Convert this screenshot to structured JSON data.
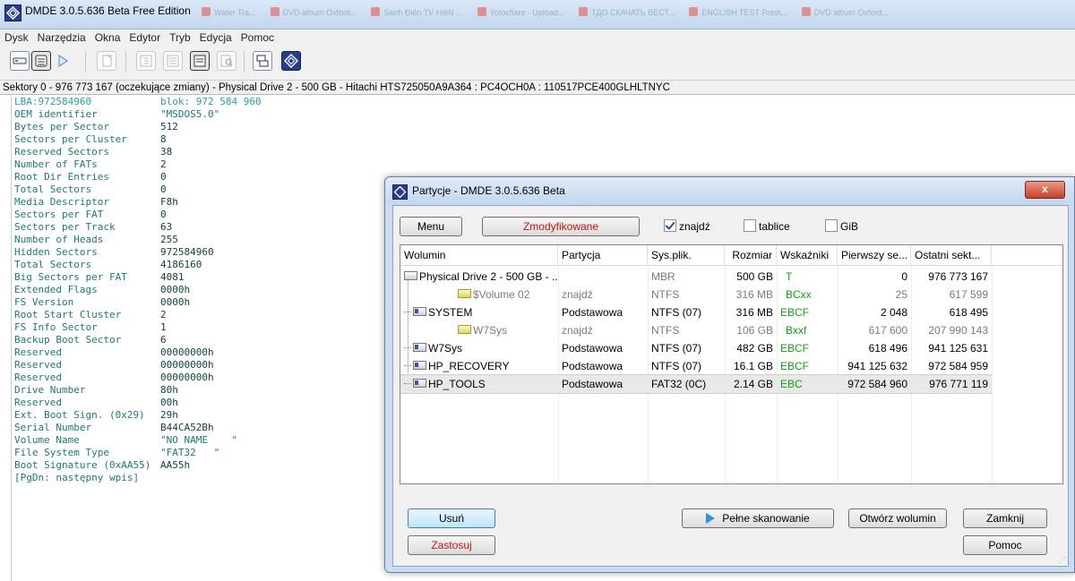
{
  "window": {
    "title": "DMDE 3.0.5.636 Beta Free Edition",
    "taskbar_tabs": [
      "Water Tra...",
      "DVD album Oxford...",
      "Sanh Điện TV HiềN ...",
      "Yotocflare - Upload...",
      "ТДО СКАЧАТЬ ВЕСТ...",
      "ENGLISH TEST Prest...",
      "DVD album Oxford..."
    ]
  },
  "menu": [
    "Dysk",
    "Narzędzia",
    "Okna",
    "Edytor",
    "Tryb",
    "Edycja",
    "Pomoc"
  ],
  "status_line": "Sektory 0 - 976 773 167 (oczekujące zmiany) - Physical Drive 2 - 500 GB - Hitachi HTS725050A9A364 : PC4OCH0A : 110517PCE400GLHLTNYC",
  "sector": {
    "header": {
      "k": "LBA:972584960",
      "v": "blok: 972 584 960"
    },
    "rows": [
      {
        "k": "OEM identifier",
        "v": "\"MSDOS5.0\""
      },
      {
        "k": "Bytes per Sector",
        "v": "512"
      },
      {
        "k": "Sectors per Cluster",
        "v": "8"
      },
      {
        "k": "Reserved Sectors",
        "v": "38"
      },
      {
        "k": "Number of FATs",
        "v": "2"
      },
      {
        "k": "Root Dir Entries",
        "v": "0"
      },
      {
        "k": "Total Sectors",
        "v": "0"
      },
      {
        "k": "Media Descriptor",
        "v": "F8h"
      },
      {
        "k": "Sectors per FAT",
        "v": "0"
      },
      {
        "k": "Sectors per Track",
        "v": "63"
      },
      {
        "k": "Number of Heads",
        "v": "255"
      },
      {
        "k": "Hidden Sectors",
        "v": "972584960"
      },
      {
        "k": "Total Sectors",
        "v": "4186160"
      },
      {
        "k": "Big Sectors per FAT",
        "v": "4081"
      },
      {
        "k": "Extended Flags",
        "v": "0000h"
      },
      {
        "k": "FS Version",
        "v": "0000h"
      },
      {
        "k": "Root Start Cluster",
        "v": "2"
      },
      {
        "k": "FS Info Sector",
        "v": "1"
      },
      {
        "k": "Backup Boot Sector",
        "v": "6"
      },
      {
        "k": "Reserved",
        "v": "00000000h"
      },
      {
        "k": "Reserved",
        "v": "00000000h"
      },
      {
        "k": "Reserved",
        "v": "00000000h"
      },
      {
        "k": "Drive Number",
        "v": "80h"
      },
      {
        "k": "Reserved",
        "v": "00h"
      },
      {
        "k": "Ext. Boot Sign. (0x29)",
        "v": "29h"
      },
      {
        "k": "Serial Number",
        "v": "B44CA52Bh"
      },
      {
        "k": "Volume Name",
        "v": "\"NO NAME    \""
      },
      {
        "k": "File System Type",
        "v": "\"FAT32   \""
      },
      {
        "k": "Boot Signature (0xAA55)",
        "v": "AA55h"
      }
    ],
    "footer": "[PgDn: następny wpis]"
  },
  "dialog": {
    "title": "Partycje - DMDE 3.0.5.636 Beta",
    "close_label": "x",
    "menu_btn": "Menu",
    "modified_btn": "Zmodyfikowane",
    "chk_found": {
      "label": "znajdź",
      "checked": true
    },
    "chk_tables": {
      "label": "tablice",
      "checked": false
    },
    "chk_gib": {
      "label": "GiB",
      "checked": false
    },
    "columns": [
      "Wolumin",
      "Partycja",
      "Sys.plik.",
      "Rozmiar",
      "Wskaźniki",
      "Pierwszy se...",
      "Ostatni sekt..."
    ],
    "rows": [
      {
        "name": "Physical Drive 2 - 500 GB - ...",
        "part": "",
        "fs": "MBR",
        "size": "500 GB",
        "flags": "T",
        "first": "0",
        "last": "976 773 167"
      },
      {
        "name": "$Volume 02",
        "part": "znajdź",
        "fs": "NTFS",
        "size": "316 MB",
        "flags": "BCxx",
        "first": "25",
        "last": "617 599"
      },
      {
        "name": "SYSTEM",
        "part": "Podstawowa",
        "fs": "NTFS (07)",
        "size": "316 MB",
        "flags": "EBCF",
        "first": "2 048",
        "last": "618 495"
      },
      {
        "name": "W7Sys",
        "part": "znajdź",
        "fs": "NTFS",
        "size": "106 GB",
        "flags": "Bxxf",
        "first": "617 600",
        "last": "207 990 143"
      },
      {
        "name": "W7Sys",
        "part": "Podstawowa",
        "fs": "NTFS (07)",
        "size": "482 GB",
        "flags": "EBCF",
        "first": "618 496",
        "last": "941 125 631"
      },
      {
        "name": "HP_RECOVERY",
        "part": "Podstawowa",
        "fs": "NTFS (07)",
        "size": "16.1 GB",
        "flags": "EBCF",
        "first": "941 125 632",
        "last": "972 584 959"
      },
      {
        "name": "HP_TOOLS",
        "part": "Podstawowa",
        "fs": "FAT32 (0C)",
        "size": "2.14 GB",
        "flags": "EBC",
        "first": "972 584 960",
        "last": "976 771 119"
      }
    ],
    "buttons": {
      "delete": "Usuń",
      "apply": "Zastosuj",
      "full_scan": "Pełne skanowanie",
      "open_volume": "Otwórz wolumin",
      "close": "Zamknij",
      "help": "Pomoc"
    }
  }
}
